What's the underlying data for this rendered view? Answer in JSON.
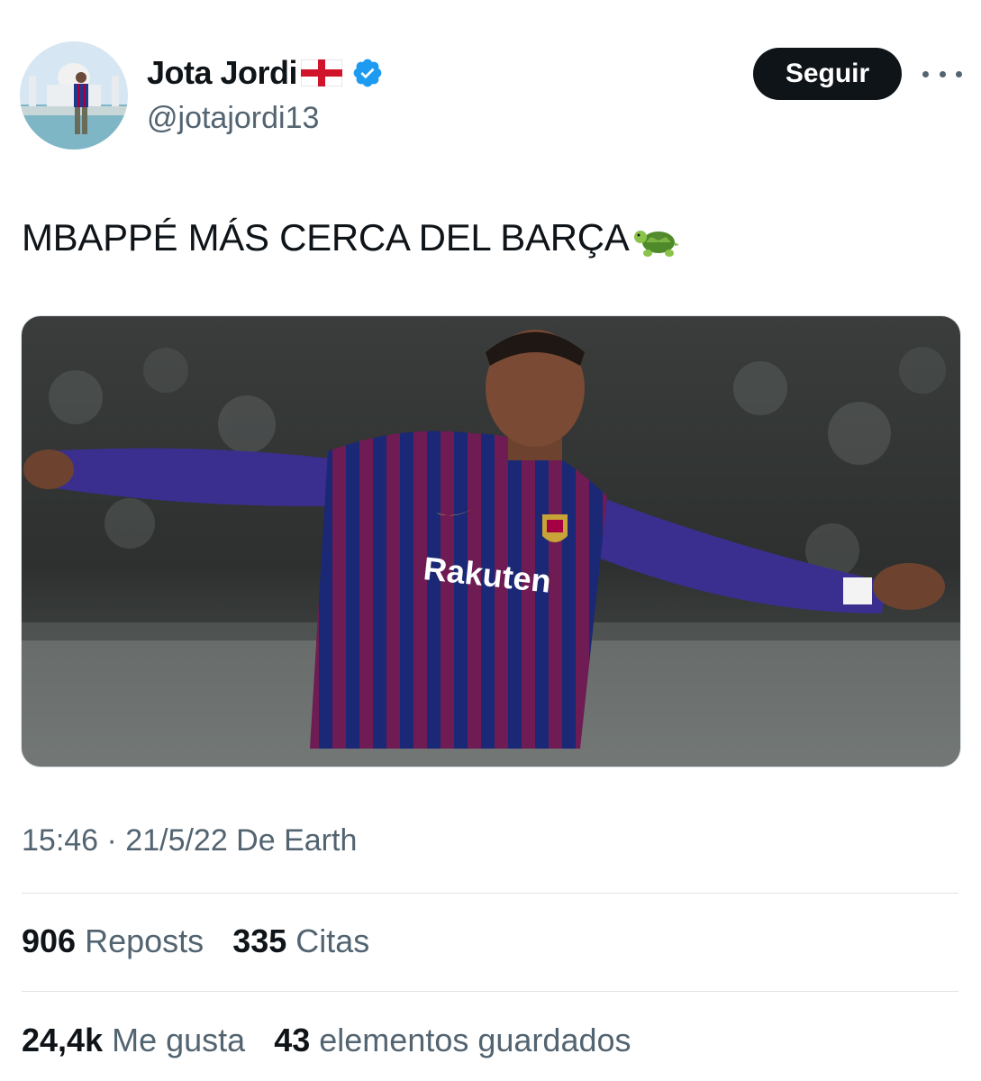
{
  "author": {
    "name": "Jota Jordi",
    "handle": "@jotajordi13",
    "avatar_icon": "avatar-photo",
    "flag_icon": "england-flag-icon",
    "verified_icon": "verified-badge-icon",
    "verified_color": "#1d9bf0"
  },
  "actions": {
    "follow_label": "Seguir",
    "more_icon": "more-options-icon"
  },
  "tweet": {
    "text": "MBAPPÉ MÁS CERCA DEL BARÇA",
    "emoji_icon": "turtle-emoji-icon",
    "media": {
      "type": "photo",
      "jersey_sponsor": "Rakuten"
    },
    "timestamp": "15:46 · 21/5/22 De Earth"
  },
  "stats": {
    "reposts_count": "906",
    "reposts_label": "Reposts",
    "quotes_count": "335",
    "quotes_label": "Citas",
    "likes_count": "24,4k",
    "likes_label": "Me gusta",
    "bookmarks_count": "43",
    "bookmarks_label": "elementos guardados"
  },
  "colors": {
    "text_primary": "#0f1419",
    "text_secondary": "#536471",
    "button_bg": "#0f1419",
    "button_text": "#ffffff"
  }
}
